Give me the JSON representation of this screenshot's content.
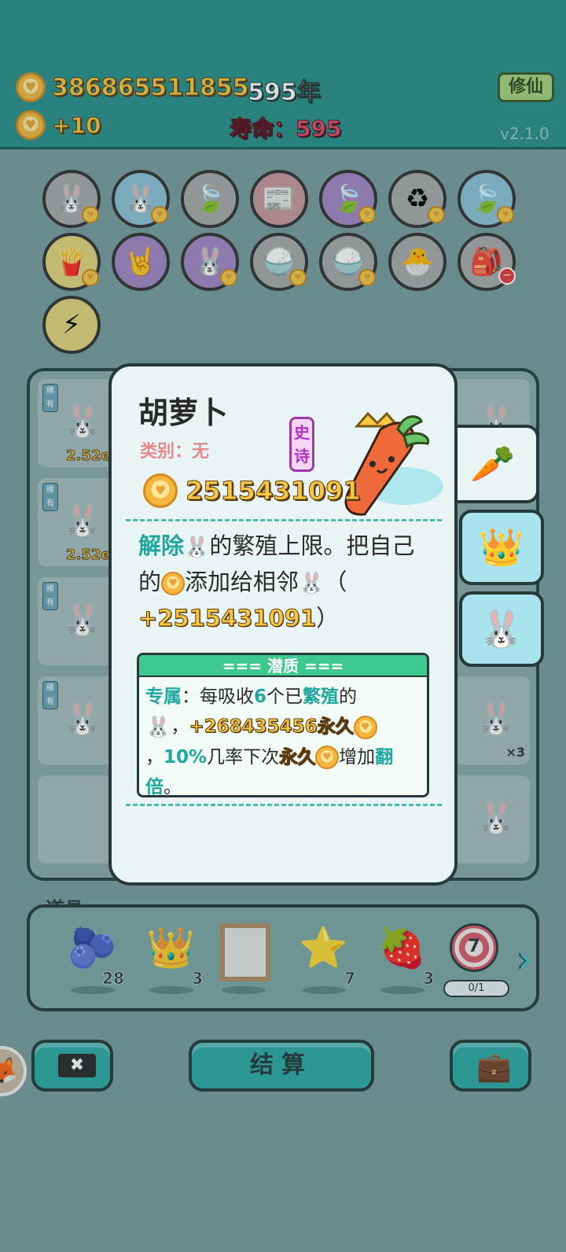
{
  "topbar": {
    "money": "386865511855",
    "years": "595年",
    "income": "+10",
    "lifespan": "寿命：595",
    "xiuxian_button": "修仙",
    "version": "v2.1.0"
  },
  "grid_icons": [
    {
      "icon": "bunny-icon",
      "glyph": "🐰",
      "color": "grey",
      "badge": true
    },
    {
      "icon": "bunny-icon",
      "glyph": "🐰",
      "color": "blue",
      "badge": true
    },
    {
      "icon": "leaf-icon",
      "glyph": "🍃",
      "color": "grey",
      "badge": false
    },
    {
      "icon": "time-magazine-icon",
      "glyph": "📰",
      "color": "pink",
      "badge": false
    },
    {
      "icon": "leaf-icon",
      "glyph": "🍃",
      "color": "purple",
      "badge": true
    },
    {
      "icon": "recycle-icon",
      "glyph": "♻",
      "color": "grey",
      "badge": true
    },
    {
      "icon": "leaf-icon",
      "glyph": "🍃",
      "color": "blue",
      "badge": true
    },
    {
      "icon": "fries-icon",
      "glyph": "🍟",
      "color": "yellow",
      "badge": true
    },
    {
      "icon": "rock-hand-icon",
      "glyph": "🤘",
      "color": "purple",
      "badge": false
    },
    {
      "icon": "bunny-icon",
      "glyph": "🐰",
      "color": "purple",
      "badge": true
    },
    {
      "icon": "rice-bowl-icon",
      "glyph": "🍚",
      "color": "grey",
      "badge": true
    },
    {
      "icon": "rice-bowl-icon",
      "glyph": "🍚",
      "color": "grey",
      "badge": true
    },
    {
      "icon": "chick-egg-icon",
      "glyph": "🐣",
      "color": "grey",
      "badge": false
    },
    {
      "icon": "sack-icon",
      "glyph": "🎒",
      "color": "grey",
      "minus": true
    },
    {
      "icon": "lightning-icon",
      "glyph": "⚡",
      "color": "yellow",
      "badge": false
    }
  ],
  "board": {
    "tag": "稀有",
    "left_values": [
      "2.52e",
      "2.52e"
    ],
    "right_multiplier": "×3"
  },
  "popup": {
    "title": "胡萝卜",
    "category": "类别：无",
    "rarity": "史诗",
    "value": "2515431091",
    "desc_part1": "解除",
    "desc_part2": "的繁殖上限。把自己的",
    "desc_part3": "添加给相邻",
    "desc_part4": "（",
    "desc_value": "+2515431091",
    "desc_part5": "）",
    "potential": {
      "header": "=== 潜质 ===",
      "p1": "专属",
      "p2": "：每吸收",
      "p3": "6",
      "p4": "个已",
      "p5": "繁殖",
      "p6": "的",
      "p7": "，",
      "p8": "+268435456永久",
      "p9": "，",
      "p10": "10%",
      "p11": "几率下次",
      "p12": "永久",
      "p13": "增加",
      "p14": "翻倍",
      "p15": "。"
    }
  },
  "items": {
    "label": "道具",
    "list": [
      {
        "icon": "blueberry-icon",
        "glyph": "🫐",
        "count": "28"
      },
      {
        "icon": "crown-icon",
        "glyph": "👑",
        "count": "3"
      },
      {
        "icon": "frame-icon",
        "glyph": "",
        "count": ""
      },
      {
        "icon": "star-icon",
        "glyph": "⭐",
        "count": "7"
      },
      {
        "icon": "strawberry-icon",
        "glyph": "🍓",
        "count": "3"
      }
    ],
    "target_number": "7",
    "target_progress": "0/1"
  },
  "buttons": {
    "close": "✖",
    "settle": "结算"
  }
}
